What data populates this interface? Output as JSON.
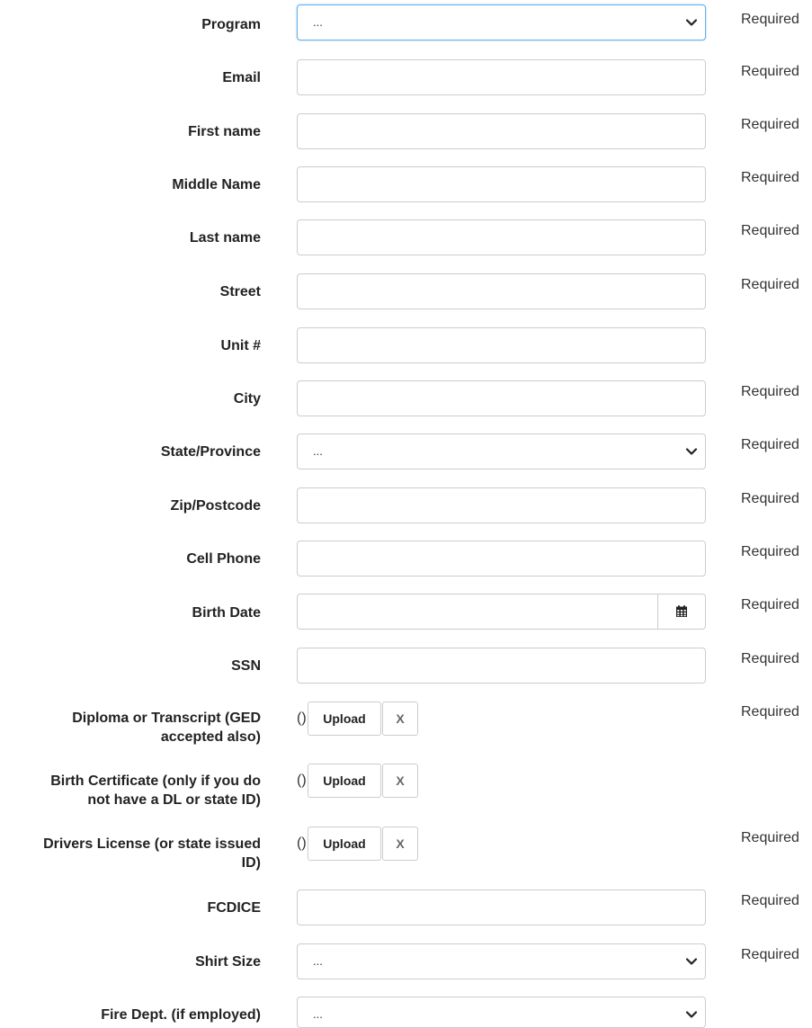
{
  "fields": {
    "program": {
      "label": "Program",
      "value": "...",
      "required": "Required"
    },
    "email": {
      "label": "Email",
      "value": "",
      "required": "Required"
    },
    "first_name": {
      "label": "First name",
      "value": "",
      "required": "Required"
    },
    "middle_name": {
      "label": "Middle Name",
      "value": "",
      "required": "Required"
    },
    "last_name": {
      "label": "Last name",
      "value": "",
      "required": "Required"
    },
    "street": {
      "label": "Street",
      "value": "",
      "required": "Required"
    },
    "unit": {
      "label": "Unit #",
      "value": ""
    },
    "city": {
      "label": "City",
      "value": "",
      "required": "Required"
    },
    "state": {
      "label": "State/Province",
      "value": "...",
      "required": "Required"
    },
    "zip": {
      "label": "Zip/Postcode",
      "value": "",
      "required": "Required"
    },
    "cell_phone": {
      "label": "Cell Phone",
      "value": "",
      "required": "Required"
    },
    "birth_date": {
      "label": "Birth Date",
      "value": "",
      "required": "Required",
      "icon": "calendar-icon"
    },
    "ssn": {
      "label": "SSN",
      "value": "",
      "required": "Required"
    },
    "diploma": {
      "label_line1": "Diploma or Transcript (GED",
      "label_line2": "accepted also)",
      "file": "()",
      "upload_label": "Upload",
      "clear_label": "X",
      "required": "Required"
    },
    "birth_certificate": {
      "label_line1": "Birth Certificate (only if you do",
      "label_line2": "not have a DL or state ID)",
      "file": "()",
      "upload_label": "Upload",
      "clear_label": "X"
    },
    "drivers_license": {
      "label_line1": "Drivers License (or state issued",
      "label_line2": "ID)",
      "file": "()",
      "upload_label": "Upload",
      "clear_label": "X",
      "required": "Required"
    },
    "fcdice": {
      "label": "FCDICE",
      "value": "",
      "required": "Required"
    },
    "shirt_size": {
      "label": "Shirt Size",
      "value": "...",
      "required": "Required"
    },
    "fire_dept": {
      "label": "Fire Dept. (if employed)",
      "value": "..."
    }
  },
  "colors": {
    "focus_border": "#66afe9",
    "border": "#cccccc",
    "text": "#222222"
  }
}
